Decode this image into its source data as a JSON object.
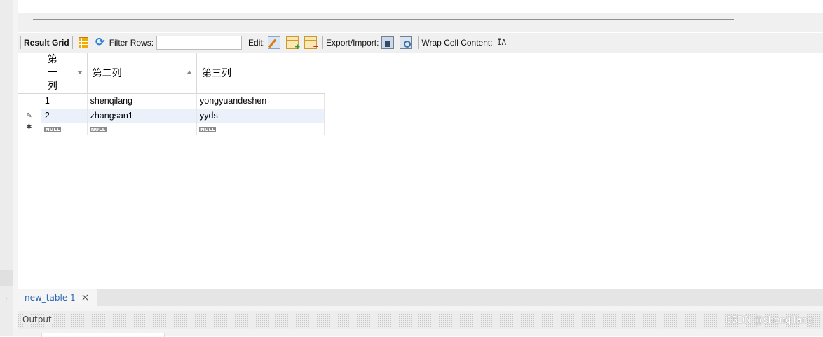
{
  "toolbar": {
    "result_grid": "Result Grid",
    "filter_rows": "Filter Rows:",
    "filter_value": "",
    "edit": "Edit:",
    "export_import": "Export/Import:",
    "wrap_cell": "Wrap Cell Content:",
    "icons": [
      "grid-icon",
      "refresh-icon",
      "edit-icon",
      "row-add-icon",
      "row-delete-icon",
      "export-icon",
      "import-icon",
      "wrap-icon"
    ]
  },
  "grid": {
    "columns": [
      "第一列",
      "第二列",
      "第三列"
    ],
    "rows": [
      {
        "marker": "",
        "cells": [
          "1",
          "shenqilang",
          "yongyuandeshen"
        ]
      },
      {
        "marker": "✎",
        "cells": [
          "2",
          "zhangsan1",
          "yyds"
        ]
      }
    ],
    "new_row": {
      "marker": "✱",
      "cells": [
        "NULL",
        "NULL",
        "NULL"
      ]
    }
  },
  "tabs": [
    {
      "label": "new_table 1",
      "close": "×"
    }
  ],
  "output": {
    "label": "Output"
  },
  "watermark": "CSDN @shenqilang",
  "colors": {
    "tab_text": "#2a66b5",
    "selected_row": "#eaf1fb",
    "null_badge": "#8a8a8a"
  }
}
